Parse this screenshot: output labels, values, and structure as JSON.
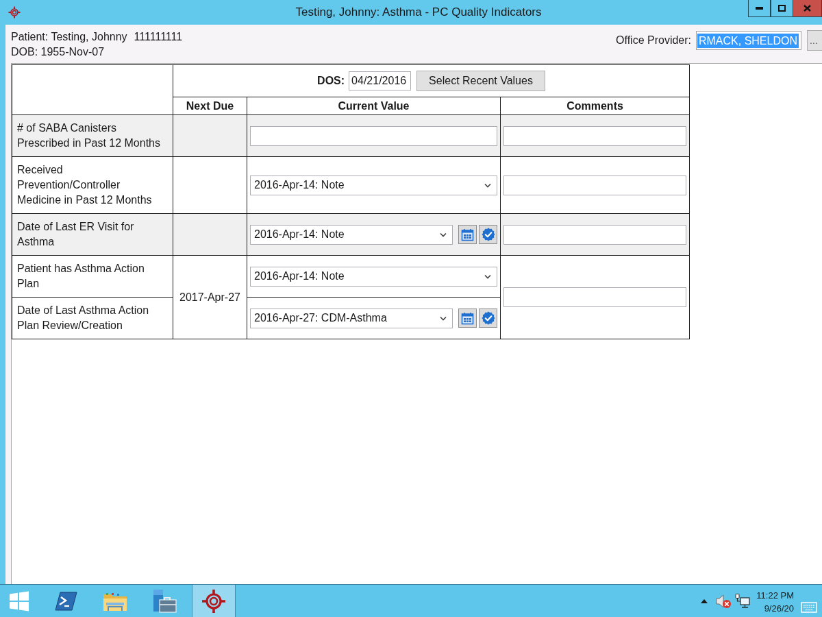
{
  "window": {
    "title": "Testing, Johnny: Asthma - PC Quality Indicators"
  },
  "patient": {
    "name": "Patient: Testing, Johnny",
    "number": "111111111",
    "dob": "DOB: 1955-Nov-07"
  },
  "office_provider": {
    "label": "Office Provider:",
    "value": "RMACK, SHELDON",
    "text_selected": true,
    "browse_button": "..."
  },
  "dos": {
    "label": "DOS:",
    "value": "04/21/2016"
  },
  "select_recent_button": "Select Recent Values",
  "columns": [
    "Next Due",
    "Current Value",
    "Comments"
  ],
  "groups": [
    {
      "shaded": true,
      "indicators": [
        {
          "label": "# of SABA Canisters Prescribed in Past 12 Months",
          "kind": "text"
        }
      ]
    },
    {
      "shaded": false,
      "indicators": [
        {
          "label": "Received Prevention/Controller Medicine in Past 12 Months",
          "kind": "select",
          "value": "2016-Apr-14: Note"
        }
      ]
    },
    {
      "shaded": true,
      "indicators": [
        {
          "label": "Date of Last ER Visit for Asthma",
          "kind": "select_tools",
          "value": "2016-Apr-14: Note"
        }
      ]
    },
    {
      "shaded": false,
      "next_due": "2017-Apr-27",
      "indicators": [
        {
          "label": "Patient has Asthma Action Plan",
          "kind": "select",
          "value": "2016-Apr-14: Note"
        },
        {
          "label": "Date of Last Asthma Action Plan Review/Creation",
          "kind": "select_tools",
          "value": "2016-Apr-27: CDM-Asthma"
        }
      ]
    }
  ],
  "taskbar": {
    "buttons": [
      {
        "kind": "start",
        "selected": false
      },
      {
        "kind": "terminal",
        "selected": false
      },
      {
        "kind": "folder",
        "selected": false
      },
      {
        "kind": "server",
        "selected": false
      },
      {
        "kind": "crosshair",
        "selected": true
      }
    ],
    "clock": {
      "time": "11:22 PM",
      "date": "9/26/20"
    }
  }
}
